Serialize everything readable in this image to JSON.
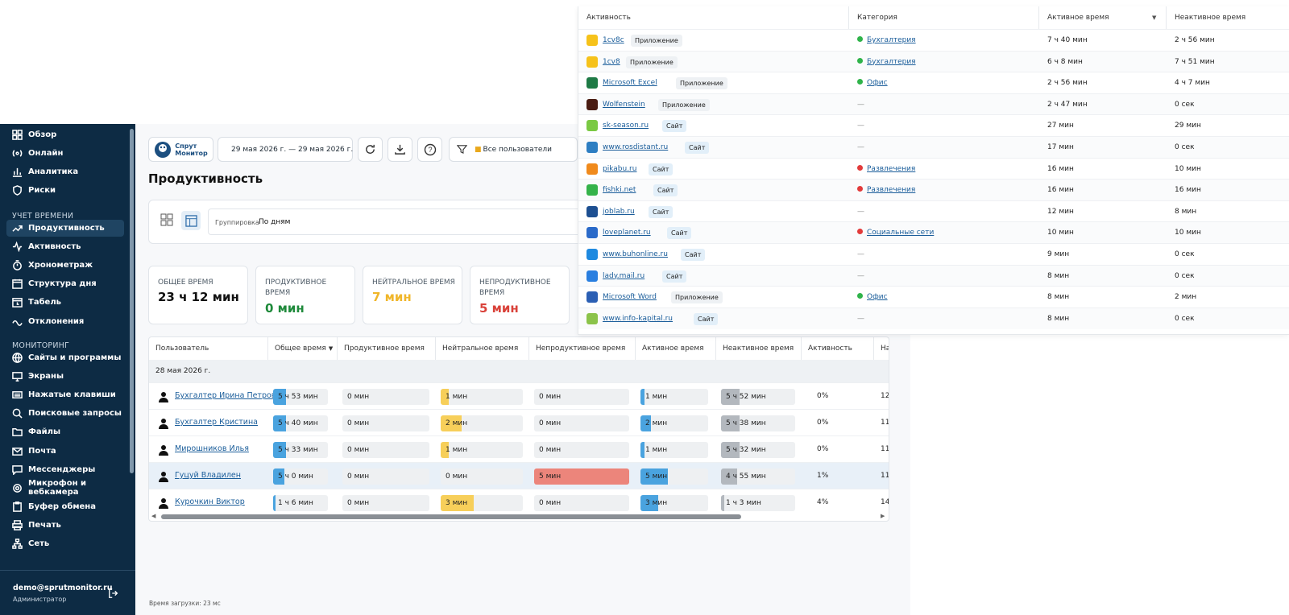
{
  "sidebar": {
    "items_top": [
      {
        "label": "Обзор",
        "icon": "dashboard-icon"
      },
      {
        "label": "Онлайн",
        "icon": "broadcast-icon"
      },
      {
        "label": "Аналитика",
        "icon": "bar-chart-icon"
      },
      {
        "label": "Риски",
        "icon": "shield-icon"
      }
    ],
    "section_time": "УЧЕТ ВРЕМЕНИ",
    "items_time": [
      {
        "label": "Продуктивность",
        "icon": "trend-icon",
        "active": true
      },
      {
        "label": "Активность",
        "icon": "pulse-icon"
      },
      {
        "label": "Хронометраж",
        "icon": "stopwatch-icon"
      },
      {
        "label": "Структура дня",
        "icon": "calendar-icon"
      },
      {
        "label": "Табель",
        "icon": "calendar-clock-icon"
      },
      {
        "label": "Отклонения",
        "icon": "deviation-icon"
      }
    ],
    "section_monitoring": "МОНИТОРИНГ",
    "items_monitoring": [
      {
        "label": "Сайты и программы",
        "icon": "globe-icon"
      },
      {
        "label": "Экраны",
        "icon": "monitor-icon"
      },
      {
        "label": "Нажатые клавиши",
        "icon": "keyboard-icon"
      },
      {
        "label": "Поисковые запросы",
        "icon": "search-icon"
      },
      {
        "label": "Файлы",
        "icon": "folder-icon"
      },
      {
        "label": "Почта",
        "icon": "mail-icon"
      },
      {
        "label": "Мессенджеры",
        "icon": "chat-icon"
      },
      {
        "label": "Микрофон и вебкамера",
        "icon": "camera-icon"
      },
      {
        "label": "Буфер обмена",
        "icon": "clipboard-icon"
      },
      {
        "label": "Печать",
        "icon": "printer-icon"
      },
      {
        "label": "Сеть",
        "icon": "network-icon"
      }
    ],
    "user_email": "demo@sprutmonitor.ru",
    "user_role": "Администратор"
  },
  "toolbar": {
    "logo_line1": "Спрут",
    "logo_line2": "Монитор",
    "date_range": "29 мая 2026 г. — 29 мая 2026 г.",
    "users_filter": "Все пользователи"
  },
  "page_title": "Продуктивность",
  "grouping": {
    "label": "Группировка",
    "value": "По дням"
  },
  "metrics": [
    {
      "label": "ОБЩЕЕ ВРЕМЯ",
      "value": "23 ч 12 мин",
      "color": "#111111"
    },
    {
      "label": "ПРОДУКТИВНОЕ ВРЕМЯ",
      "value": "0 мин",
      "color": "#1f8a3b"
    },
    {
      "label": "НЕЙТРАЛЬНОЕ ВРЕМЯ",
      "value": "7 мин",
      "color": "#f0b62a"
    },
    {
      "label": "НЕПРОДУКТИВНОЕ ВРЕМЯ",
      "value": "5 мин",
      "color": "#d9423a"
    }
  ],
  "users_table": {
    "columns": [
      "Пользователь",
      "Общее время",
      "Продуктивное время",
      "Нейтральное время",
      "Непродуктивное время",
      "Активное время",
      "Неактивное время",
      "Активность",
      "На"
    ],
    "group_date": "28 мая 2026 г.",
    "rows": [
      {
        "name": "Бухгалтер Ирина Петрова",
        "total": "5 ч 53 мин",
        "total_frac": 0.23,
        "productive": "0 мин",
        "neutral": "1 мин",
        "neutral_frac": 0.1,
        "unproductive": "0 мин",
        "unprod_frac": 0,
        "active": "1 мин",
        "active_frac": 0.06,
        "inactive": "5 ч 52 мин",
        "inactive_frac": 0.25,
        "activity": "0%",
        "last": "12"
      },
      {
        "name": "Бухгалтер Кристина",
        "total": "5 ч 40 мин",
        "total_frac": 0.23,
        "productive": "0 мин",
        "neutral": "2 мин",
        "neutral_frac": 0.25,
        "unproductive": "0 мин",
        "unprod_frac": 0,
        "active": "2 мин",
        "active_frac": 0.15,
        "inactive": "5 ч 38 мин",
        "inactive_frac": 0.25,
        "activity": "0%",
        "last": "11"
      },
      {
        "name": "Мирошников Илья",
        "total": "5 ч 33 мин",
        "total_frac": 0.23,
        "productive": "0 мин",
        "neutral": "1 мин",
        "neutral_frac": 0.1,
        "unproductive": "0 мин",
        "unprod_frac": 0,
        "active": "1 мин",
        "active_frac": 0.06,
        "inactive": "5 ч 32 мин",
        "inactive_frac": 0.25,
        "activity": "0%",
        "last": "11"
      },
      {
        "name": "Гуцуй Владилен",
        "total": "5 ч 0 мин",
        "total_frac": 0.2,
        "productive": "0 мин",
        "neutral": "0 мин",
        "neutral_frac": 0,
        "unproductive": "5 мин",
        "unprod_frac": 1.0,
        "active": "5 мин",
        "active_frac": 0.4,
        "inactive": "4 ч 55 мин",
        "inactive_frac": 0.22,
        "activity": "1%",
        "last": "11",
        "highlight": true
      },
      {
        "name": "Курочкин Виктор",
        "total": "1 ч 6 мин",
        "total_frac": 0.04,
        "productive": "0 мин",
        "neutral": "3 мин",
        "neutral_frac": 0.4,
        "unproductive": "0 мин",
        "unprod_frac": 0,
        "active": "3 мин",
        "active_frac": 0.26,
        "inactive": "1 ч 3 мин",
        "inactive_frac": 0.04,
        "activity": "4%",
        "last": "14"
      }
    ]
  },
  "activity_panel": {
    "columns": [
      "Активность",
      "Категория",
      "Активное время",
      "Неактивное время"
    ],
    "rows": [
      {
        "name": "1cv8c",
        "type": "Приложение",
        "category": "Бухгалтерия",
        "cat_color": "#2fb34a",
        "active": "7 ч 40 мин",
        "inactive": "2 ч 56 мин",
        "icon_color": "#f6c21a"
      },
      {
        "name": "1cv8",
        "type": "Приложение",
        "category": "Бухгалтерия",
        "cat_color": "#2fb34a",
        "active": "6 ч 8 мин",
        "inactive": "7 ч 51 мин",
        "icon_color": "#f6c21a"
      },
      {
        "name": "Microsoft Excel",
        "type": "Приложение",
        "category": "Офис",
        "cat_color": "#2fb34a",
        "active": "2 ч 56 мин",
        "inactive": "4 ч 7 мин",
        "icon_color": "#1e7a45"
      },
      {
        "name": "Wolfenstein",
        "type": "Приложение",
        "category": "—",
        "cat_color": "",
        "active": "2 ч 47 мин",
        "inactive": "0 сек",
        "icon_color": "#4a1c12"
      },
      {
        "name": "sk-season.ru",
        "type": "Сайт",
        "category": "—",
        "cat_color": "",
        "active": "27 мин",
        "inactive": "29 мин",
        "icon_color": "#7ac943"
      },
      {
        "name": "www.rosdistant.ru",
        "type": "Сайт",
        "category": "—",
        "cat_color": "",
        "active": "17 мин",
        "inactive": "0 сек",
        "icon_color": "#2d7ec2"
      },
      {
        "name": "pikabu.ru",
        "type": "Сайт",
        "category": "Развлечения",
        "cat_color": "#e23b3b",
        "active": "16 мин",
        "inactive": "10 мин",
        "icon_color": "#f08a1c"
      },
      {
        "name": "fishki.net",
        "type": "Сайт",
        "category": "Развлечения",
        "cat_color": "#e23b3b",
        "active": "16 мин",
        "inactive": "16 мин",
        "icon_color": "#35b34a"
      },
      {
        "name": "joblab.ru",
        "type": "Сайт",
        "category": "—",
        "cat_color": "",
        "active": "12 мин",
        "inactive": "8 мин",
        "icon_color": "#1d4f91"
      },
      {
        "name": "loveplanet.ru",
        "type": "Сайт",
        "category": "Социальные сети",
        "cat_color": "#e23b3b",
        "active": "10 мин",
        "inactive": "10 мин",
        "icon_color": "#2a6ac9"
      },
      {
        "name": "www.buhonline.ru",
        "type": "Сайт",
        "category": "—",
        "cat_color": "",
        "active": "9 мин",
        "inactive": "0 сек",
        "icon_color": "#1f8ae0"
      },
      {
        "name": "lady.mail.ru",
        "type": "Сайт",
        "category": "—",
        "cat_color": "",
        "active": "8 мин",
        "inactive": "0 сек",
        "icon_color": "#2a7fe0"
      },
      {
        "name": "Microsoft Word",
        "type": "Приложение",
        "category": "Офис",
        "cat_color": "#2fb34a",
        "active": "8 мин",
        "inactive": "2 мин",
        "icon_color": "#2b5fb4"
      },
      {
        "name": "www.info-kapital.ru",
        "type": "Сайт",
        "category": "—",
        "cat_color": "",
        "active": "8 мин",
        "inactive": "0 сек",
        "icon_color": "#8bc34a"
      }
    ]
  },
  "load_time": "Время загрузки: 23 мс"
}
